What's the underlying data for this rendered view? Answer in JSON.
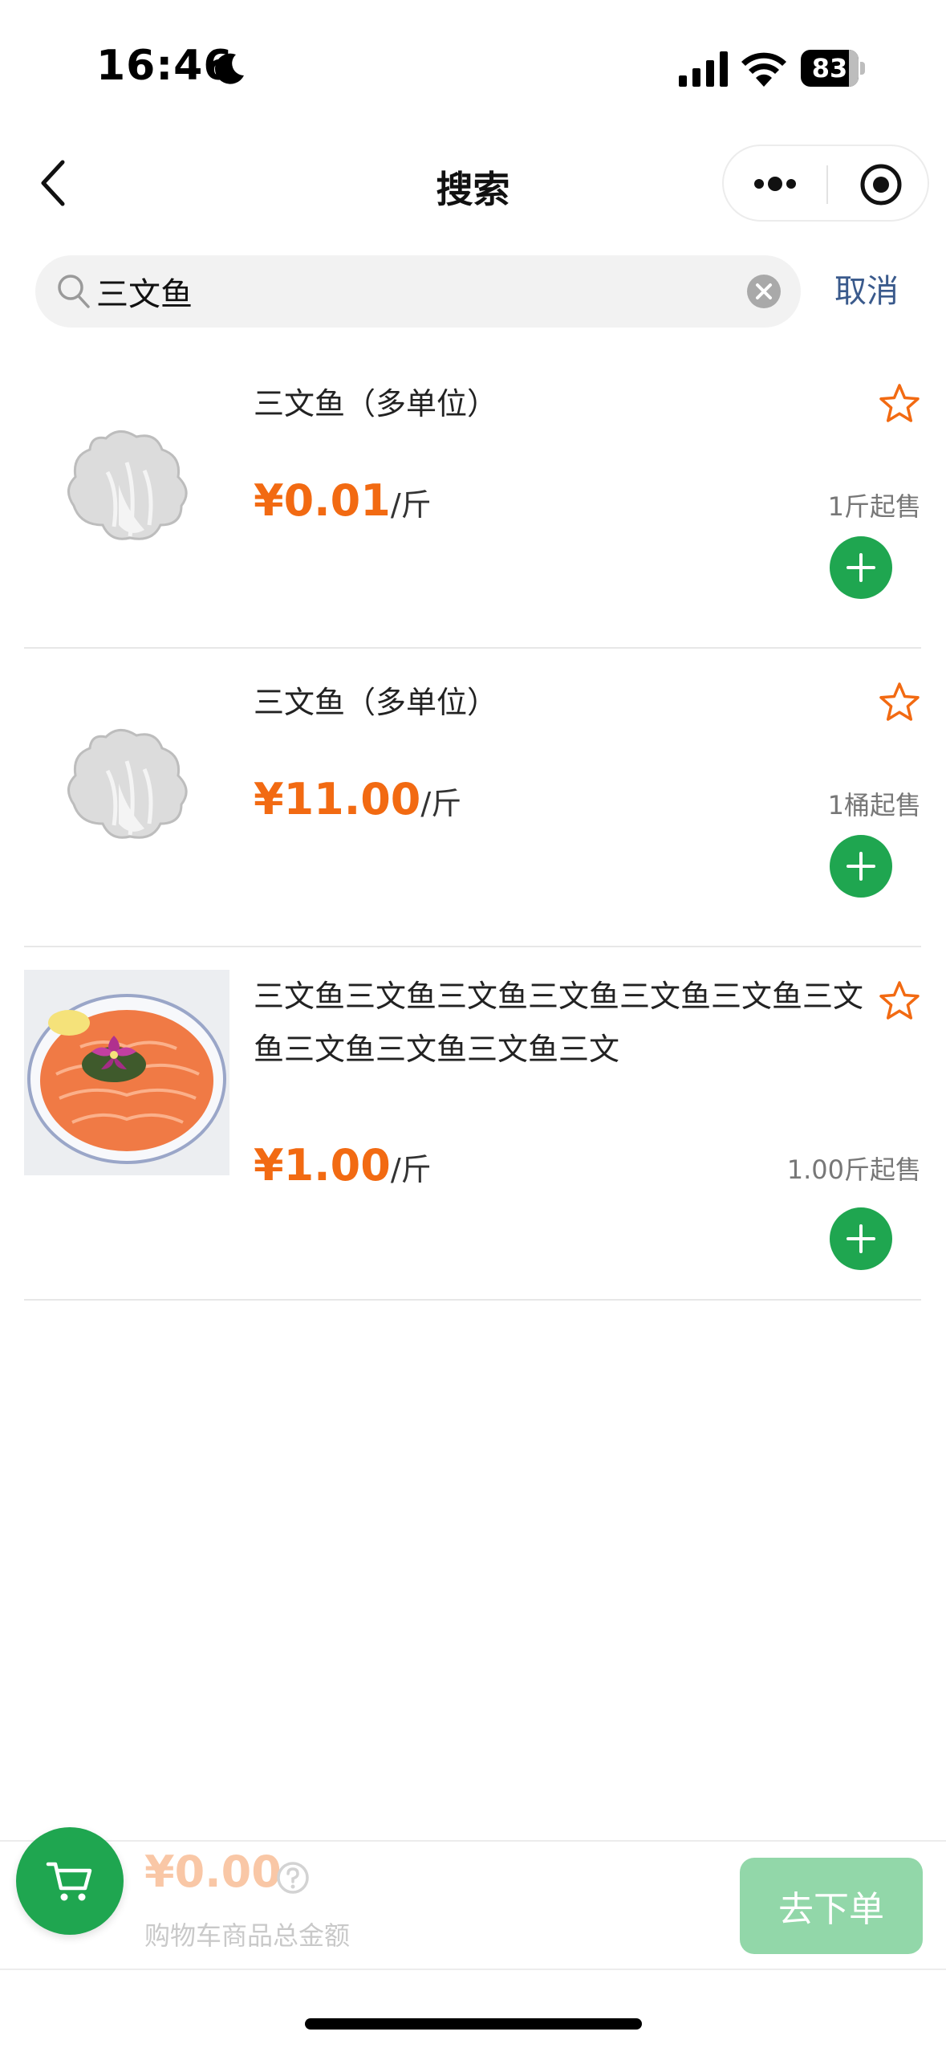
{
  "status_bar": {
    "time": "16:46",
    "battery": "83",
    "battery_level": 0.83,
    "icons": [
      "moon-icon",
      "signal-icon",
      "wifi-icon",
      "battery-icon"
    ]
  },
  "nav": {
    "title": "搜索",
    "icons": [
      "back-icon",
      "more-icon",
      "close-miniprogram-icon"
    ]
  },
  "search": {
    "query": "三文鱼",
    "cancel_label": "取消"
  },
  "products": [
    {
      "name": "三文鱼（多单位）",
      "price": "¥0.01",
      "unit": "/斤",
      "min_qty": "1斤起售",
      "image": "placeholder"
    },
    {
      "name": "三文鱼（多单位）",
      "price": "¥11.00",
      "unit": "/斤",
      "min_qty": "1桶起售",
      "image": "placeholder"
    },
    {
      "name": "三文鱼三文鱼三文鱼三文鱼三文鱼三文鱼三文鱼三文鱼三文鱼三文鱼三文",
      "price": "¥1.00",
      "unit": "/斤",
      "min_qty": "1.00斤起售",
      "image": "salmon-photo"
    }
  ],
  "cart": {
    "total": "¥0.00",
    "total_label": "购物车商品总金额",
    "checkout_label": "去下单"
  },
  "colors": {
    "price": "#f26a12",
    "green": "#1fa650",
    "checkout_disabled": "#92d7a9",
    "cancel": "#3a5a8c"
  }
}
